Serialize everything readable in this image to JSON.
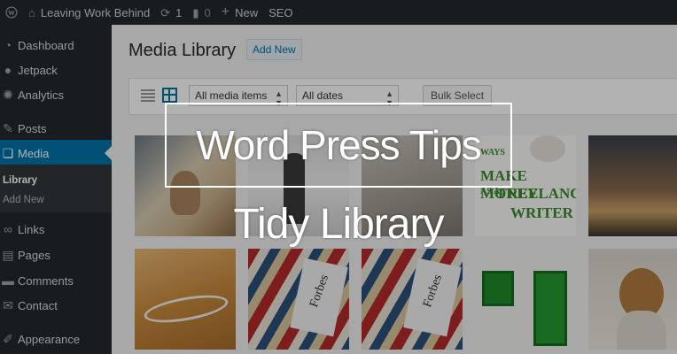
{
  "adminbar": {
    "site_name": "Leaving Work Behind",
    "updates_count": "1",
    "comments_count": "0",
    "new_label": "New",
    "seo_label": "SEO"
  },
  "sidebar": {
    "items": [
      {
        "label": "Dashboard",
        "icon": "dashboard-icon"
      },
      {
        "label": "Jetpack",
        "icon": "jetpack-icon"
      },
      {
        "label": "Analytics",
        "icon": "analytics-icon"
      },
      {
        "label": "Posts",
        "icon": "pin-icon"
      },
      {
        "label": "Media",
        "icon": "media-icon"
      },
      {
        "label": "Links",
        "icon": "link-icon"
      },
      {
        "label": "Pages",
        "icon": "page-icon"
      },
      {
        "label": "Comments",
        "icon": "comment-icon"
      },
      {
        "label": "Contact",
        "icon": "mail-icon"
      },
      {
        "label": "Appearance",
        "icon": "brush-icon"
      }
    ],
    "submenu": [
      "Library",
      "Add New"
    ]
  },
  "main": {
    "title": "Media Library",
    "add_new": "Add New",
    "filter_type": "All media items",
    "filter_date": "All dates",
    "bulk_select": "Bulk Select"
  },
  "thumbnails": {
    "t4_line1": "WAYS",
    "t4_line2": "MAKE MONEY",
    "t4_line3": "AS A",
    "t4_line4": "FREELANCE",
    "t4_line5": "WRITER",
    "t7_label": "Forbes",
    "t8_label": "Forbes"
  },
  "overlay": {
    "title": "Word Press Tips",
    "subtitle": "Tidy Library"
  },
  "colors": {
    "admin_dark": "#23282d",
    "accent": "#0073aa",
    "main_bg": "#f1f1f1"
  }
}
